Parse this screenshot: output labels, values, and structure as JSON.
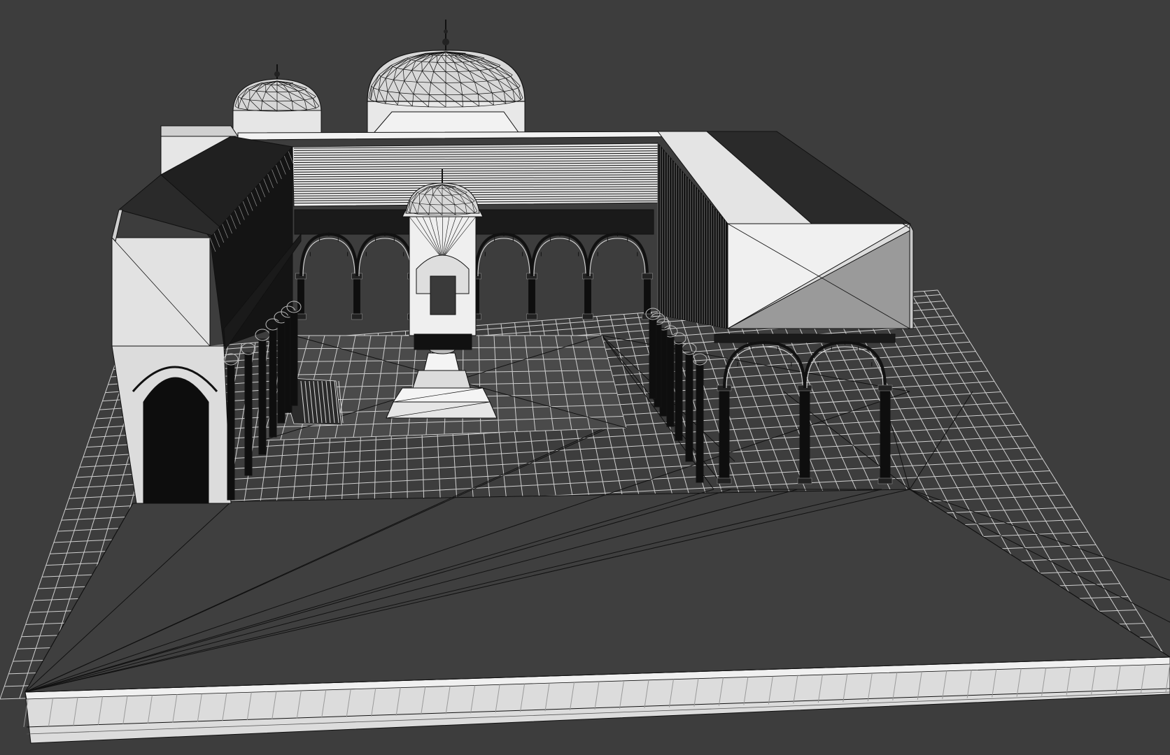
{
  "viewport": {
    "background_color": "#3d3d3d",
    "shading_mode": "shaded-wireframe",
    "wire_color": "#000000",
    "surface_light": "#e4e4e4",
    "surface_mid": "#b4b4b4",
    "surface_dark": "#111111",
    "grid_color": "#cfcfcf",
    "ground_color": "#3f3f3f"
  },
  "scene": {
    "objects": [
      "ground-grid",
      "base-slab",
      "courtyard-building",
      "main-dome",
      "secondary-dome",
      "fountain-kiosk",
      "central-fountain",
      "left-arcade",
      "right-arcade",
      "back-arcade",
      "front-right-arcade"
    ]
  }
}
